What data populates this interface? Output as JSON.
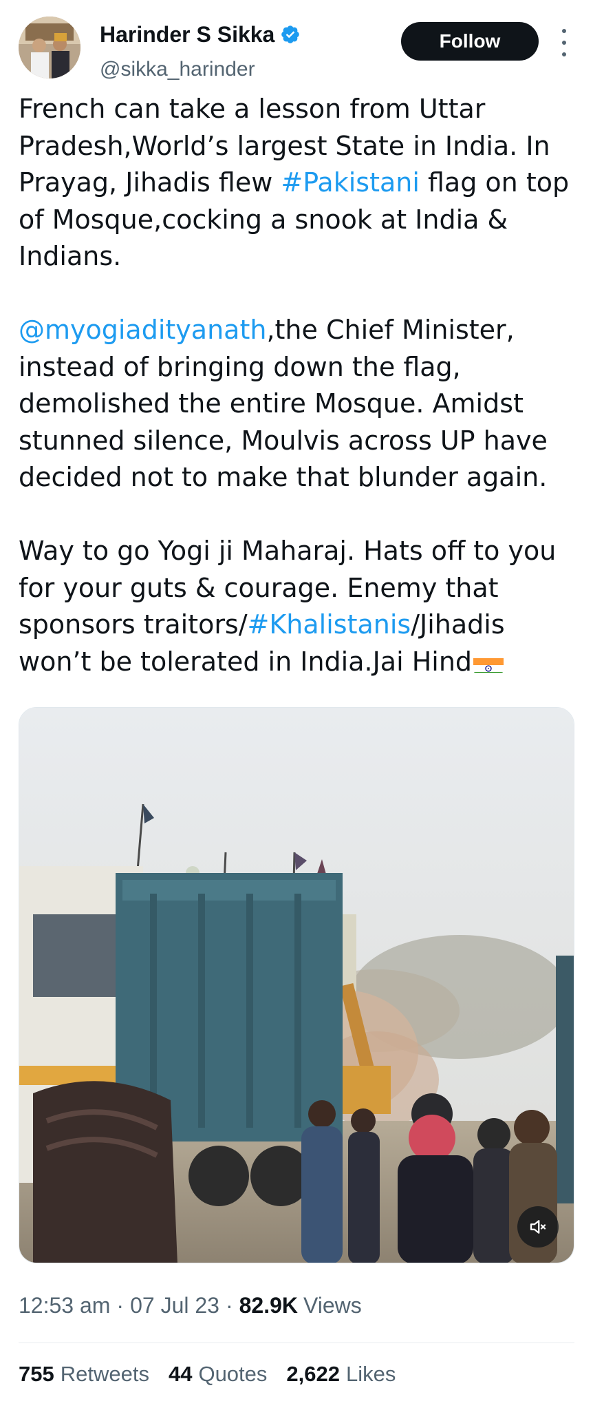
{
  "author": {
    "name": "Harinder S Sikka",
    "handle": "@sikka_harinder",
    "verified": true
  },
  "actions": {
    "follow_label": "Follow",
    "more_icon": "more-vertical-icon"
  },
  "tweet": {
    "p1": {
      "t1": "French can take a lesson from Uttar Pradesh,World’s largest State in India. In Prayag, Jihadis flew ",
      "tag": "#Pakistani",
      "t2": " flag on top of Mosque,cocking a snook at India & Indians."
    },
    "p2": {
      "mention": "@myogiadityanath",
      "t1": ",the Chief Minister, instead of bringing down the flag, demolished the entire Mosque. Amidst stunned silence, Moulvis across UP have decided not to make that blunder again."
    },
    "p3": {
      "t1": "Way to go Yogi ji Maharaj. Hats off to you for your guts & courage. Enemy that sponsors traitors/",
      "tag": "#Khalistanis",
      "t2": "/Jihadis won’t be tolerated in India.Jai Hind",
      "emoji": "india-flag-emoji"
    }
  },
  "media": {
    "type": "video",
    "mute_icon": "speaker-muted-icon"
  },
  "meta": {
    "time": "12:53 am",
    "date": "07 Jul 23",
    "views_count": "82.9K",
    "views_label": "Views"
  },
  "stats": {
    "retweets_count": "755",
    "retweets_label": "Retweets",
    "quotes_count": "44",
    "quotes_label": "Quotes",
    "likes_count": "2,622",
    "likes_label": "Likes"
  },
  "colors": {
    "link": "#1d9bf0",
    "text": "#0f1419",
    "secondary": "#536471",
    "button_bg": "#0f1419"
  }
}
